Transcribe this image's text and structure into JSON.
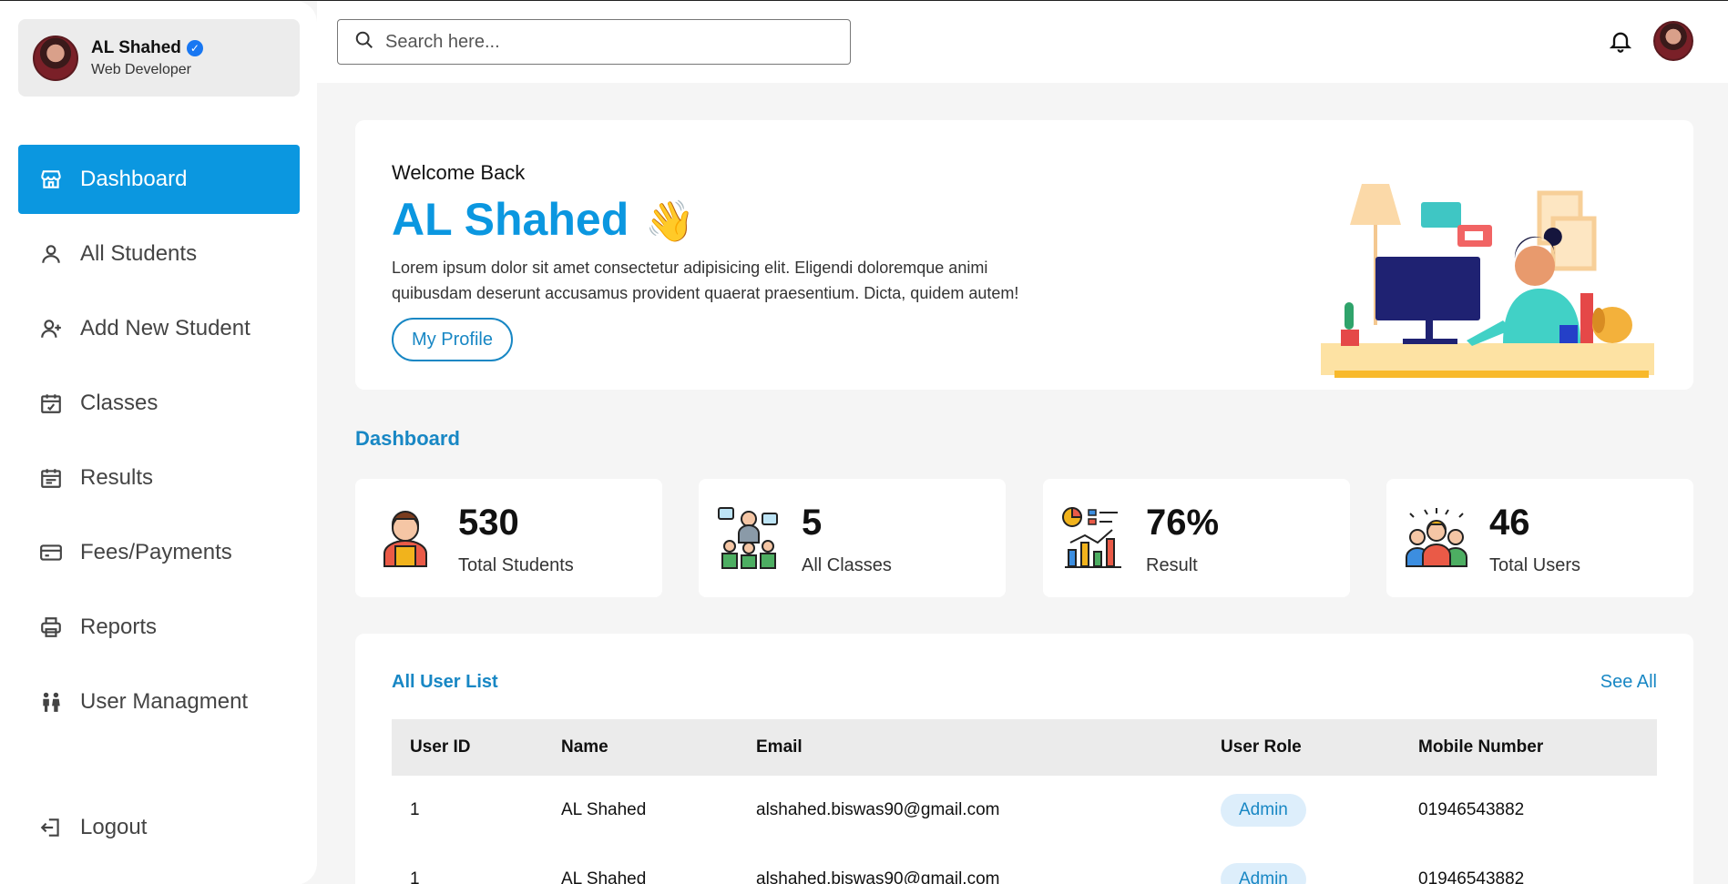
{
  "profile": {
    "name": "AL Shahed",
    "role": "Web Developer",
    "verified_mark": "✓"
  },
  "sidebar": {
    "items": [
      {
        "label": "Dashboard",
        "icon": "store-icon",
        "active": true
      },
      {
        "label": "All Students",
        "icon": "user-icon"
      },
      {
        "label": "Add New Student",
        "icon": "user-plus-icon"
      },
      {
        "label": "Classes",
        "icon": "calendar-check-icon"
      },
      {
        "label": "Results",
        "icon": "calendar-list-icon"
      },
      {
        "label": "Fees/Payments",
        "icon": "credit-card-icon"
      },
      {
        "label": "Reports",
        "icon": "printer-icon"
      },
      {
        "label": "User Managment",
        "icon": "users-icon"
      }
    ],
    "logout": "Logout"
  },
  "header": {
    "search_placeholder": "Search here..."
  },
  "welcome": {
    "subtitle": "Welcome Back",
    "name": "AL Shahed",
    "emoji": "👋",
    "text": "Lorem ipsum dolor sit amet consectetur adipisicing elit. Eligendi doloremque animi quibusdam deserunt accusamus provident quaerat praesentium. Dicta, quidem autem!",
    "button": "My Profile"
  },
  "dashboard": {
    "title": "Dashboard",
    "stats": [
      {
        "value": "530",
        "label": "Total Students",
        "icon": "student-icon"
      },
      {
        "value": "5",
        "label": "All Classes",
        "icon": "classroom-icon"
      },
      {
        "value": "76%",
        "label": "Result",
        "icon": "chart-icon"
      },
      {
        "value": "46",
        "label": "Total Users",
        "icon": "group-icon"
      }
    ]
  },
  "userlist": {
    "title": "All User List",
    "see_all": "See All",
    "columns": [
      "User ID",
      "Name",
      "Email",
      "User Role",
      "Mobile Number"
    ],
    "rows": [
      [
        "1",
        "AL Shahed",
        "alshahed.biswas90@gmail.com",
        "Admin",
        "01946543882"
      ],
      [
        "1",
        "AL Shahed",
        "alshahed.biswas90@gmail.com",
        "Admin",
        "01946543882"
      ]
    ]
  },
  "colors": {
    "accent": "#0b97e0",
    "link": "#1887c4",
    "badge_bg": "#ddeefb"
  }
}
